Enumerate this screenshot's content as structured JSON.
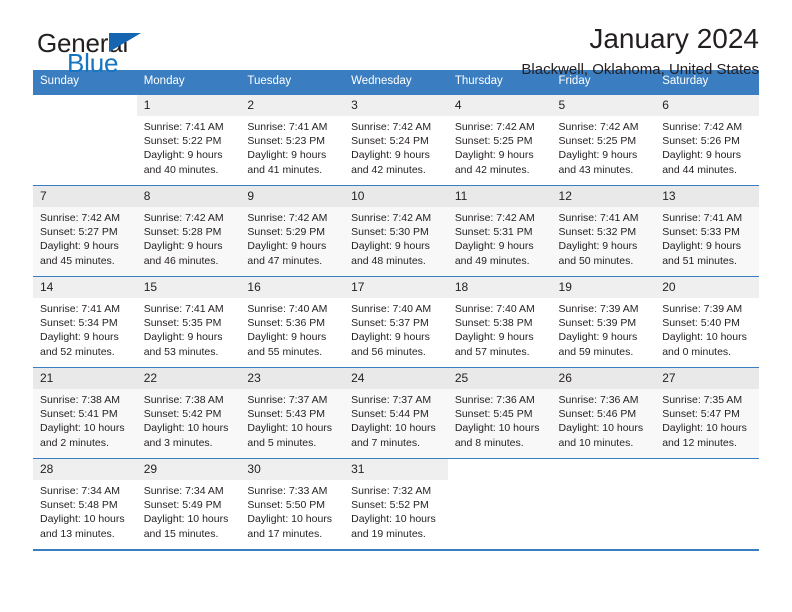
{
  "brand": {
    "word1": "General",
    "word2": "Blue",
    "triangle_color": "#1565b0",
    "text_color": "#231f20",
    "blue_color": "#1675c0"
  },
  "header": {
    "title": "January 2024",
    "subtitle": "Blackwell, Oklahoma, United States"
  },
  "calendar": {
    "header_bg": "#3a7dc0",
    "weekdays": [
      "Sunday",
      "Monday",
      "Tuesday",
      "Wednesday",
      "Thursday",
      "Friday",
      "Saturday"
    ],
    "weeks": [
      [
        {
          "day": "",
          "sunrise": "",
          "sunset": "",
          "daylight": ""
        },
        {
          "day": "1",
          "sunrise": "Sunrise: 7:41 AM",
          "sunset": "Sunset: 5:22 PM",
          "daylight": "Daylight: 9 hours and 40 minutes."
        },
        {
          "day": "2",
          "sunrise": "Sunrise: 7:41 AM",
          "sunset": "Sunset: 5:23 PM",
          "daylight": "Daylight: 9 hours and 41 minutes."
        },
        {
          "day": "3",
          "sunrise": "Sunrise: 7:42 AM",
          "sunset": "Sunset: 5:24 PM",
          "daylight": "Daylight: 9 hours and 42 minutes."
        },
        {
          "day": "4",
          "sunrise": "Sunrise: 7:42 AM",
          "sunset": "Sunset: 5:25 PM",
          "daylight": "Daylight: 9 hours and 42 minutes."
        },
        {
          "day": "5",
          "sunrise": "Sunrise: 7:42 AM",
          "sunset": "Sunset: 5:25 PM",
          "daylight": "Daylight: 9 hours and 43 minutes."
        },
        {
          "day": "6",
          "sunrise": "Sunrise: 7:42 AM",
          "sunset": "Sunset: 5:26 PM",
          "daylight": "Daylight: 9 hours and 44 minutes."
        }
      ],
      [
        {
          "day": "7",
          "sunrise": "Sunrise: 7:42 AM",
          "sunset": "Sunset: 5:27 PM",
          "daylight": "Daylight: 9 hours and 45 minutes."
        },
        {
          "day": "8",
          "sunrise": "Sunrise: 7:42 AM",
          "sunset": "Sunset: 5:28 PM",
          "daylight": "Daylight: 9 hours and 46 minutes."
        },
        {
          "day": "9",
          "sunrise": "Sunrise: 7:42 AM",
          "sunset": "Sunset: 5:29 PM",
          "daylight": "Daylight: 9 hours and 47 minutes."
        },
        {
          "day": "10",
          "sunrise": "Sunrise: 7:42 AM",
          "sunset": "Sunset: 5:30 PM",
          "daylight": "Daylight: 9 hours and 48 minutes."
        },
        {
          "day": "11",
          "sunrise": "Sunrise: 7:42 AM",
          "sunset": "Sunset: 5:31 PM",
          "daylight": "Daylight: 9 hours and 49 minutes."
        },
        {
          "day": "12",
          "sunrise": "Sunrise: 7:41 AM",
          "sunset": "Sunset: 5:32 PM",
          "daylight": "Daylight: 9 hours and 50 minutes."
        },
        {
          "day": "13",
          "sunrise": "Sunrise: 7:41 AM",
          "sunset": "Sunset: 5:33 PM",
          "daylight": "Daylight: 9 hours and 51 minutes."
        }
      ],
      [
        {
          "day": "14",
          "sunrise": "Sunrise: 7:41 AM",
          "sunset": "Sunset: 5:34 PM",
          "daylight": "Daylight: 9 hours and 52 minutes."
        },
        {
          "day": "15",
          "sunrise": "Sunrise: 7:41 AM",
          "sunset": "Sunset: 5:35 PM",
          "daylight": "Daylight: 9 hours and 53 minutes."
        },
        {
          "day": "16",
          "sunrise": "Sunrise: 7:40 AM",
          "sunset": "Sunset: 5:36 PM",
          "daylight": "Daylight: 9 hours and 55 minutes."
        },
        {
          "day": "17",
          "sunrise": "Sunrise: 7:40 AM",
          "sunset": "Sunset: 5:37 PM",
          "daylight": "Daylight: 9 hours and 56 minutes."
        },
        {
          "day": "18",
          "sunrise": "Sunrise: 7:40 AM",
          "sunset": "Sunset: 5:38 PM",
          "daylight": "Daylight: 9 hours and 57 minutes."
        },
        {
          "day": "19",
          "sunrise": "Sunrise: 7:39 AM",
          "sunset": "Sunset: 5:39 PM",
          "daylight": "Daylight: 9 hours and 59 minutes."
        },
        {
          "day": "20",
          "sunrise": "Sunrise: 7:39 AM",
          "sunset": "Sunset: 5:40 PM",
          "daylight": "Daylight: 10 hours and 0 minutes."
        }
      ],
      [
        {
          "day": "21",
          "sunrise": "Sunrise: 7:38 AM",
          "sunset": "Sunset: 5:41 PM",
          "daylight": "Daylight: 10 hours and 2 minutes."
        },
        {
          "day": "22",
          "sunrise": "Sunrise: 7:38 AM",
          "sunset": "Sunset: 5:42 PM",
          "daylight": "Daylight: 10 hours and 3 minutes."
        },
        {
          "day": "23",
          "sunrise": "Sunrise: 7:37 AM",
          "sunset": "Sunset: 5:43 PM",
          "daylight": "Daylight: 10 hours and 5 minutes."
        },
        {
          "day": "24",
          "sunrise": "Sunrise: 7:37 AM",
          "sunset": "Sunset: 5:44 PM",
          "daylight": "Daylight: 10 hours and 7 minutes."
        },
        {
          "day": "25",
          "sunrise": "Sunrise: 7:36 AM",
          "sunset": "Sunset: 5:45 PM",
          "daylight": "Daylight: 10 hours and 8 minutes."
        },
        {
          "day": "26",
          "sunrise": "Sunrise: 7:36 AM",
          "sunset": "Sunset: 5:46 PM",
          "daylight": "Daylight: 10 hours and 10 minutes."
        },
        {
          "day": "27",
          "sunrise": "Sunrise: 7:35 AM",
          "sunset": "Sunset: 5:47 PM",
          "daylight": "Daylight: 10 hours and 12 minutes."
        }
      ],
      [
        {
          "day": "28",
          "sunrise": "Sunrise: 7:34 AM",
          "sunset": "Sunset: 5:48 PM",
          "daylight": "Daylight: 10 hours and 13 minutes."
        },
        {
          "day": "29",
          "sunrise": "Sunrise: 7:34 AM",
          "sunset": "Sunset: 5:49 PM",
          "daylight": "Daylight: 10 hours and 15 minutes."
        },
        {
          "day": "30",
          "sunrise": "Sunrise: 7:33 AM",
          "sunset": "Sunset: 5:50 PM",
          "daylight": "Daylight: 10 hours and 17 minutes."
        },
        {
          "day": "31",
          "sunrise": "Sunrise: 7:32 AM",
          "sunset": "Sunset: 5:52 PM",
          "daylight": "Daylight: 10 hours and 19 minutes."
        },
        {
          "day": "",
          "sunrise": "",
          "sunset": "",
          "daylight": ""
        },
        {
          "day": "",
          "sunrise": "",
          "sunset": "",
          "daylight": ""
        },
        {
          "day": "",
          "sunrise": "",
          "sunset": "",
          "daylight": ""
        }
      ]
    ]
  }
}
